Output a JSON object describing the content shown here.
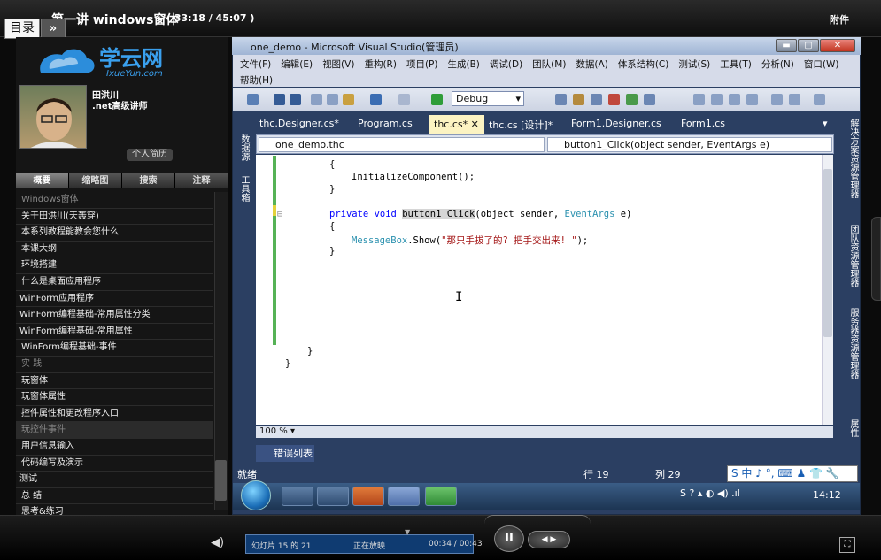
{
  "header": {
    "course_title": "第一讲 windows窗体",
    "time": "( 33:18 / 45:07 )",
    "attach": "附件",
    "toc_button": "目录",
    "collapse_button": "»"
  },
  "logo": {
    "cn": "学云网",
    "en": "IxueYun.com"
  },
  "teacher": {
    "name": "田洪川",
    "title": ".net高级讲师",
    "bio_button": "个人简历"
  },
  "nav_tabs": [
    "概要",
    "缩略图",
    "搜索",
    "注释"
  ],
  "toc": [
    {
      "label": "Windows窗体",
      "kind": "sec"
    },
    {
      "label": "关于田洪川(天轰穿)",
      "kind": "sub"
    },
    {
      "label": "本系列教程能教会您什么",
      "kind": "sub"
    },
    {
      "label": "本课大纲",
      "kind": "sub"
    },
    {
      "label": "环境搭建",
      "kind": "sub"
    },
    {
      "label": "什么是桌面应用程序",
      "kind": "sub"
    },
    {
      "label": "WinForm应用程序",
      "kind": "top"
    },
    {
      "label": "WinForm编程基础-常用属性分类",
      "kind": "top"
    },
    {
      "label": "WinForm编程基础-常用属性",
      "kind": "top"
    },
    {
      "label": "WinForm编程基础-事件",
      "kind": "sub"
    },
    {
      "label": "实 践",
      "kind": "sec"
    },
    {
      "label": "玩窗体",
      "kind": "sub"
    },
    {
      "label": "玩窗体属性",
      "kind": "sub"
    },
    {
      "label": "控件属性和更改程序入口",
      "kind": "sub"
    },
    {
      "label": "玩控件事件",
      "kind": "sec hl"
    },
    {
      "label": "用户信息输入",
      "kind": "sub"
    },
    {
      "label": "代码编写及演示",
      "kind": "sub"
    },
    {
      "label": "测试",
      "kind": "top"
    },
    {
      "label": "总 结",
      "kind": "sub"
    },
    {
      "label": "思考&练习",
      "kind": "sub"
    }
  ],
  "vs": {
    "title": "one_demo - Microsoft Visual Studio(管理员)",
    "menu_row1": [
      "文件(F)",
      "编辑(E)",
      "视图(V)",
      "重构(R)",
      "项目(P)",
      "生成(B)",
      "调试(D)",
      "团队(M)",
      "数据(A)",
      "体系结构(C)",
      "测试(S)",
      "工具(T)",
      "分析(N)",
      "窗口(W)"
    ],
    "menu_row2": [
      "帮助(H)"
    ],
    "config": "Debug",
    "tabs": [
      "thc.Designer.cs*",
      "Program.cs",
      "thc.cs*",
      "thc.cs [设计]*",
      "Form1.Designer.cs",
      "Form1.cs"
    ],
    "active_tab_index": 2,
    "left_strip": [
      "数据源",
      "工具箱"
    ],
    "right_strip": [
      "解决方案资源管理器",
      "团队资源管理器",
      "服务器资源管理器",
      "属性"
    ],
    "nav_left": "one_demo.thc",
    "nav_right": "button1_Click(object sender, EventArgs e)",
    "code": {
      "l1": "{",
      "l2": "InitializeComponent();",
      "l3": "}",
      "l4_kw": "private void",
      "l4_name": "button1_Click",
      "l4_rest1": "(object sender, ",
      "l4_type": "EventArgs",
      "l4_rest2": " e)",
      "l5": "{",
      "l6_type": "MessageBox",
      "l6_mid": ".Show(",
      "l6_str": "\"那只手拔了的? 把手交出来! \"",
      "l6_end": ");",
      "l7": "}",
      "l8": "}",
      "l9": "}"
    },
    "zoom": "100 %",
    "errors_tab": "错误列表",
    "status_ready": "就绪",
    "status_row": "行 19",
    "status_col": "列 29",
    "ime": "S 中 ♪ °, ⌨ ♟ 👕 🔧",
    "clock": "14:12"
  },
  "player": {
    "slide": "幻灯片 15 的 21",
    "status": "正在放映",
    "time": "00:34 / 00:43",
    "pause": "II",
    "step": "◀ ▶"
  }
}
